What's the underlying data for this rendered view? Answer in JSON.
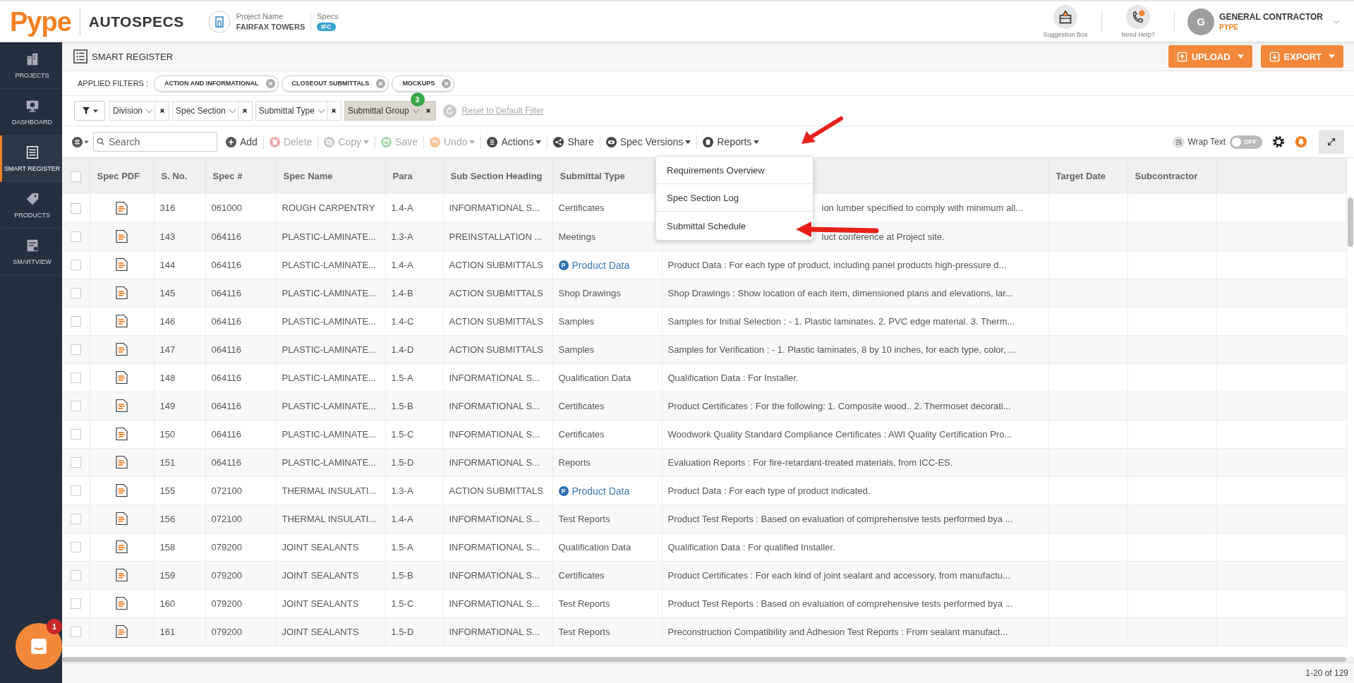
{
  "header": {
    "logo": "Pype",
    "product": "AUTOSPECS",
    "project_label": "Project Name",
    "project_name": "FAIRFAX TOWERS",
    "specs_label": "Specs",
    "specs_badge": "IFC",
    "suggestion": "Suggestion Box",
    "help": "Need Help?",
    "user_initial": "G",
    "user_name": "GENERAL CONTRACTOR",
    "user_company": "PYPE"
  },
  "sidebar": {
    "items": [
      {
        "label": "PROJECTS",
        "selected": false
      },
      {
        "label": "DASHBOARD",
        "selected": false
      },
      {
        "label": "SMART REGISTER",
        "selected": true
      },
      {
        "label": "PRODUCTS",
        "selected": false
      },
      {
        "label": "SMARTVIEW",
        "selected": false
      }
    ]
  },
  "page": {
    "title": "SMART REGISTER",
    "upload": "UPLOAD",
    "export": "EXPORT"
  },
  "applied_filters": {
    "label": "APPLIED FILTERS :",
    "chips": [
      "ACTION AND INFORMATIONAL",
      "CLOSEOUT SUBMITTALS",
      "MOCKUPS"
    ]
  },
  "filters": [
    {
      "label": "Division",
      "active": false
    },
    {
      "label": "Spec Section",
      "active": false
    },
    {
      "label": "Submittal Type",
      "active": false
    },
    {
      "label": "Submittal Group",
      "active": true,
      "badge": "3"
    }
  ],
  "reset": "Reset to Default Filter",
  "toolbar": {
    "search_placeholder": "Search",
    "actions": [
      {
        "label": "Add",
        "disabled": false,
        "caret": false
      },
      {
        "label": "Delete",
        "disabled": true,
        "caret": false
      },
      {
        "label": "Copy",
        "disabled": true,
        "caret": true
      },
      {
        "label": "Save",
        "disabled": true,
        "caret": false
      },
      {
        "label": "Undo",
        "disabled": true,
        "caret": true
      },
      {
        "label": "Actions",
        "disabled": false,
        "caret": true
      },
      {
        "label": "Share",
        "disabled": false,
        "caret": false
      },
      {
        "label": "Spec Versions",
        "disabled": false,
        "caret": true
      },
      {
        "label": "Reports",
        "disabled": false,
        "caret": true
      }
    ],
    "wrap_text": "Wrap Text",
    "wrap_toggle": {
      "label": "OFF",
      "on": false
    }
  },
  "reports_menu": {
    "items": [
      "Requirements Overview",
      "Spec Section Log",
      "Submittal Schedule"
    ]
  },
  "table": {
    "select_all": {
      "checked": false
    },
    "columns_left": [
      "Spec PDF",
      "S. No.",
      "Spec #",
      "Spec Name",
      "Para",
      "Sub Section Heading",
      "Submittal Type"
    ],
    "columns_right": [
      "Target Date",
      "Subcontractor"
    ],
    "rows": [
      {
        "checked": false,
        "s_no": "316",
        "spec": "061000",
        "spec_name": "ROUGH CARPENTRY",
        "para": "1.4-A",
        "heading": "INFORMATIONAL S...",
        "type": {
          "kind": "text",
          "label": "Certificates"
        },
        "description": "ion lumber specified to comply with minimum all...",
        "under_menu": true
      },
      {
        "checked": false,
        "s_no": "143",
        "spec": "064116",
        "spec_name": "PLASTIC-LAMINATE...",
        "para": "1.3-A",
        "heading": "PREINSTALLATION ...",
        "type": {
          "kind": "text",
          "label": "Meetings"
        },
        "description": "luct conference at Project site.",
        "under_menu": true
      },
      {
        "checked": false,
        "s_no": "144",
        "spec": "064116",
        "spec_name": "PLASTIC-LAMINATE...",
        "para": "1.4-A",
        "heading": "ACTION SUBMITTALS",
        "type": {
          "kind": "product",
          "badge": "P",
          "label": "Product Data"
        },
        "description": "Product Data : For each type of product, including panel products high-pressure d...",
        "under_menu": false
      },
      {
        "checked": false,
        "s_no": "145",
        "spec": "064116",
        "spec_name": "PLASTIC-LAMINATE...",
        "para": "1.4-B",
        "heading": "ACTION SUBMITTALS",
        "type": {
          "kind": "text",
          "label": "Shop Drawings"
        },
        "description": "Shop Drawings : Show location of each item, dimensioned plans and elevations, lar...",
        "under_menu": false
      },
      {
        "checked": false,
        "s_no": "146",
        "spec": "064116",
        "spec_name": "PLASTIC-LAMINATE...",
        "para": "1.4-C",
        "heading": "ACTION SUBMITTALS",
        "type": {
          "kind": "text",
          "label": "Samples"
        },
        "description": "Samples for Initial Selection : - 1. Plastic laminates. 2. PVC edge material. 3. Therm...",
        "under_menu": false
      },
      {
        "checked": false,
        "s_no": "147",
        "spec": "064116",
        "spec_name": "PLASTIC-LAMINATE...",
        "para": "1.4-D",
        "heading": "ACTION SUBMITTALS",
        "type": {
          "kind": "text",
          "label": "Samples"
        },
        "description": "Samples for Verification : - 1. Plastic laminates, 8 by 10 inches, for each type, color, ...",
        "under_menu": false
      },
      {
        "checked": false,
        "s_no": "148",
        "spec": "064116",
        "spec_name": "PLASTIC-LAMINATE...",
        "para": "1.5-A",
        "heading": "INFORMATIONAL S...",
        "type": {
          "kind": "text",
          "label": "Qualification Data"
        },
        "description": "Qualification Data : For Installer.",
        "under_menu": false
      },
      {
        "checked": false,
        "s_no": "149",
        "spec": "064116",
        "spec_name": "PLASTIC-LAMINATE...",
        "para": "1.5-B",
        "heading": "INFORMATIONAL S...",
        "type": {
          "kind": "text",
          "label": "Certificates"
        },
        "description": "Product Certificates : For the following: 1. Composite wood.. 2. Thermoset decorati...",
        "under_menu": false
      },
      {
        "checked": false,
        "s_no": "150",
        "spec": "064116",
        "spec_name": "PLASTIC-LAMINATE...",
        "para": "1.5-C",
        "heading": "INFORMATIONAL S...",
        "type": {
          "kind": "text",
          "label": "Certificates"
        },
        "description": "Woodwork Quality Standard Compliance Certificates : AWI Quality Certification Pro...",
        "under_menu": false
      },
      {
        "checked": false,
        "s_no": "151",
        "spec": "064116",
        "spec_name": "PLASTIC-LAMINATE...",
        "para": "1.5-D",
        "heading": "INFORMATIONAL S...",
        "type": {
          "kind": "text",
          "label": "Reports"
        },
        "description": "Evaluation Reports : For fire-retardant-treated materials, from ICC-ES.",
        "under_menu": false
      },
      {
        "checked": false,
        "s_no": "155",
        "spec": "072100",
        "spec_name": "THERMAL INSULATI...",
        "para": "1.3-A",
        "heading": "ACTION SUBMITTALS",
        "type": {
          "kind": "product",
          "badge": "P",
          "label": "Product Data"
        },
        "description": "Product Data : For each type of product indicated.",
        "under_menu": false
      },
      {
        "checked": false,
        "s_no": "156",
        "spec": "072100",
        "spec_name": "THERMAL INSULATI...",
        "para": "1.4-A",
        "heading": "INFORMATIONAL S...",
        "type": {
          "kind": "text",
          "label": "Test Reports"
        },
        "description": "Product Test Reports : Based on evaluation of comprehensive tests performed bya ...",
        "under_menu": false
      },
      {
        "checked": false,
        "s_no": "158",
        "spec": "079200",
        "spec_name": "JOINT SEALANTS",
        "para": "1.5-A",
        "heading": "INFORMATIONAL S...",
        "type": {
          "kind": "text",
          "label": "Qualification Data"
        },
        "description": "Qualification Data : For qualified Installer.",
        "under_menu": false
      },
      {
        "checked": false,
        "s_no": "159",
        "spec": "079200",
        "spec_name": "JOINT SEALANTS",
        "para": "1.5-B",
        "heading": "INFORMATIONAL S...",
        "type": {
          "kind": "text",
          "label": "Certificates"
        },
        "description": "Product Certificates : For each kind of joint sealant and accessory, from manufactu...",
        "under_menu": false
      },
      {
        "checked": false,
        "s_no": "160",
        "spec": "079200",
        "spec_name": "JOINT SEALANTS",
        "para": "1.5-C",
        "heading": "INFORMATIONAL S...",
        "type": {
          "kind": "text",
          "label": "Test Reports"
        },
        "description": "Product Test Reports : Based on evaluation of comprehensive tests performed bya ...",
        "under_menu": false
      },
      {
        "checked": false,
        "s_no": "161",
        "spec": "079200",
        "spec_name": "JOINT SEALANTS",
        "para": "1.5-D",
        "heading": "INFORMATIONAL S...",
        "type": {
          "kind": "text",
          "label": "Test Reports"
        },
        "description": "Preconstruction Compatibility and Adhesion Test Reports : From sealant manufact...",
        "under_menu": false
      }
    ]
  },
  "pagination": "1-20 of 129",
  "chat": {
    "badge": "1"
  }
}
